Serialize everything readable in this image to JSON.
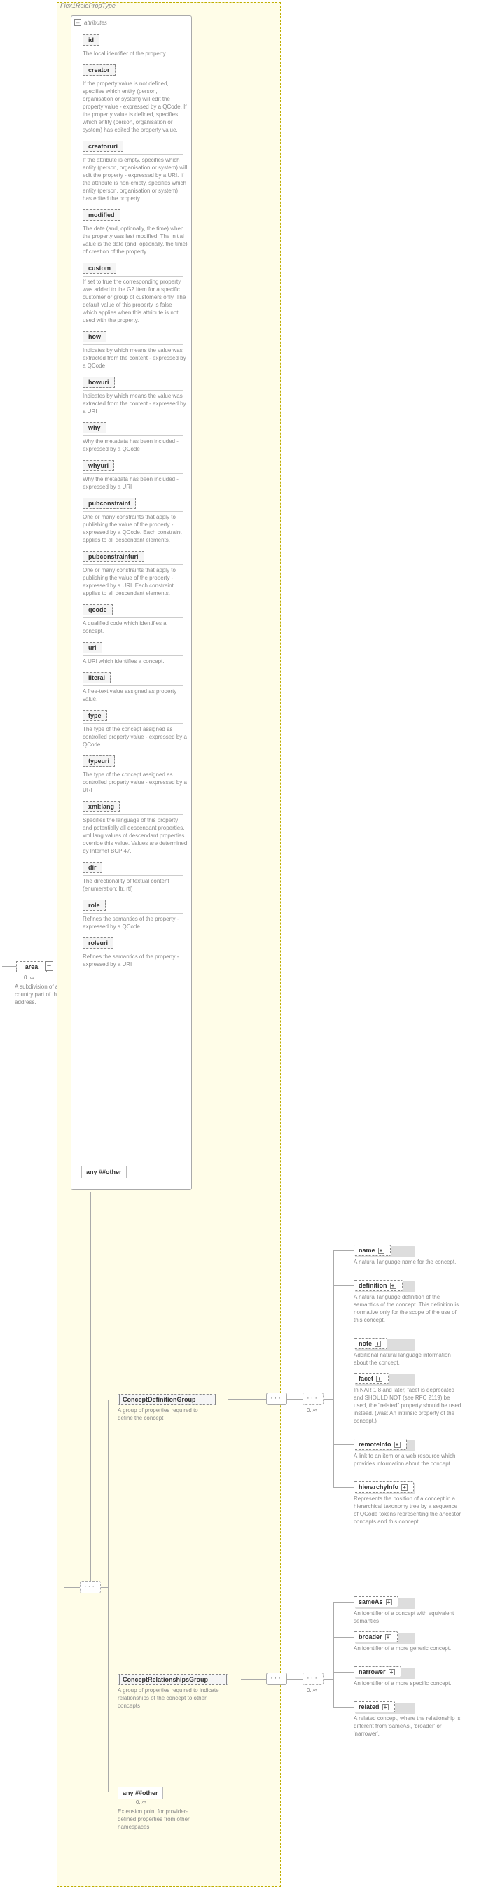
{
  "type_title": "Flex1RolePropType",
  "attributes_label": "attributes",
  "area": {
    "name": "area",
    "occ": "0..∞",
    "desc": "A subdivision of a country part of the address."
  },
  "any1": {
    "label": "any ##other"
  },
  "attrs": [
    {
      "name": "id",
      "desc": "The local identifier of the property."
    },
    {
      "name": "creator",
      "desc": "If the property value is not defined, specifies which entity (person, organisation or system) will edit the property value - expressed by a QCode. If the property value is defined, specifies which entity (person, organisation or system) has edited the property value."
    },
    {
      "name": "creatoruri",
      "desc": "If the attribute is empty, specifies which entity (person, organisation or system) will edit the property - expressed by a URI. If the attribute is non-empty, specifies which entity (person, organisation or system) has edited the property."
    },
    {
      "name": "modified",
      "desc": "The date (and, optionally, the time) when the property was last modified. The initial value is the date (and, optionally, the time) of creation of the property."
    },
    {
      "name": "custom",
      "desc": "If set to true the corresponding property was added to the G2 Item for a specific customer or group of customers only. The default value of this property is false which applies when this attribute is not used with the property."
    },
    {
      "name": "how",
      "desc": "Indicates by which means the value was extracted from the content - expressed by a QCode"
    },
    {
      "name": "howuri",
      "desc": "Indicates by which means the value was extracted from the content - expressed by a URI"
    },
    {
      "name": "why",
      "desc": "Why the metadata has been included - expressed by a QCode"
    },
    {
      "name": "whyuri",
      "desc": "Why the metadata has been included - expressed by a URI"
    },
    {
      "name": "pubconstraint",
      "desc": "One or many constraints that apply to publishing the value of the property - expressed by a QCode. Each constraint applies to all descendant elements."
    },
    {
      "name": "pubconstrainturi",
      "desc": "One or many constraints that apply to publishing the value of the property - expressed by a URI. Each constraint applies to all descendant elements."
    },
    {
      "name": "qcode",
      "desc": "A qualified code which identifies a concept."
    },
    {
      "name": "uri",
      "desc": "A URI which identifies a concept."
    },
    {
      "name": "literal",
      "desc": "A free-text value assigned as property value."
    },
    {
      "name": "type",
      "desc": "The type of the concept assigned as controlled property value - expressed by a QCode"
    },
    {
      "name": "typeuri",
      "desc": "The type of the concept assigned as controlled property value - expressed by a URI"
    },
    {
      "name": "xml:lang",
      "desc": "Specifies the language of this property and potentially all descendant properties. xml:lang values of descendant properties override this value. Values are determined by Internet BCP 47."
    },
    {
      "name": "dir",
      "desc": "The directionality of textual content (enumeration: ltr, rtl)"
    },
    {
      "name": "role",
      "desc": "Refines the semantics of the property - expressed by a QCode"
    },
    {
      "name": "roleuri",
      "desc": "Refines the semantics of the property - expressed by a URI"
    }
  ],
  "groups": {
    "def": {
      "name": "ConceptDefinitionGroup",
      "desc": "A group of properties required to define the concept"
    },
    "rel": {
      "name": "ConceptRelationshipsGroup",
      "desc": "A group of properties required to indicate relationships of the concept to other concepts"
    }
  },
  "def_children_occ": "0..∞",
  "rel_children_occ": "0..∞",
  "def_children": [
    {
      "name": "name",
      "desc": "A natural language name for the concept."
    },
    {
      "name": "definition",
      "desc": "A natural language definition of the semantics of the concept. This definition is normative only for the scope of the use of this concept."
    },
    {
      "name": "note",
      "desc": "Additional natural language information about the concept."
    },
    {
      "name": "facet",
      "desc": "In NAR 1.8 and later, facet is deprecated and SHOULD NOT (see RFC 2119) be used, the \"related\" property should be used instead. (was: An intrinsic property of the concept.)"
    },
    {
      "name": "remoteInfo",
      "desc": "A link to an item or a web resource which provides information about the concept"
    },
    {
      "name": "hierarchyInfo",
      "desc": "Represents the position of a concept in a hierarchical taxonomy tree by a sequence of QCode tokens representing the ancestor concepts and this concept"
    }
  ],
  "rel_children": [
    {
      "name": "sameAs",
      "desc": "An identifier of a concept with equivalent semantics"
    },
    {
      "name": "broader",
      "desc": "An identifier of a more generic concept."
    },
    {
      "name": "narrower",
      "desc": "An identifier of a more specific concept."
    },
    {
      "name": "related",
      "desc": "A related concept, where the relationship is different from 'sameAs', 'broader' or 'narrower'."
    }
  ],
  "any2": {
    "label": "any ##other",
    "occ": "0..∞",
    "desc": "Extension point for provider-defined properties from other namespaces"
  }
}
